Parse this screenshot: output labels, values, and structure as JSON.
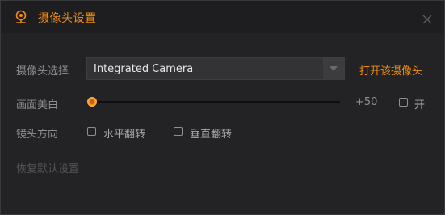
{
  "dialog": {
    "title": "摄像头设置",
    "title_icon": "webcam-icon",
    "close_icon": "close-icon"
  },
  "camera_select": {
    "label": "摄像头选择",
    "value": "Integrated Camera",
    "open_link": "打开该摄像头"
  },
  "beauty": {
    "label": "画面美白",
    "value_text": "+50",
    "level": 0,
    "toggle_label": "开",
    "toggle_checked": false
  },
  "mirror": {
    "label": "镜头方向",
    "horizontal_label": "水平翻转",
    "horizontal_checked": false,
    "vertical_label": "垂直翻转",
    "vertical_checked": false
  },
  "restore_label": "恢复默认设置",
  "colors": {
    "accent": "#f08c13",
    "background": "#232325",
    "titlebar": "#1e1e20",
    "text_muted": "#8e8e90"
  }
}
